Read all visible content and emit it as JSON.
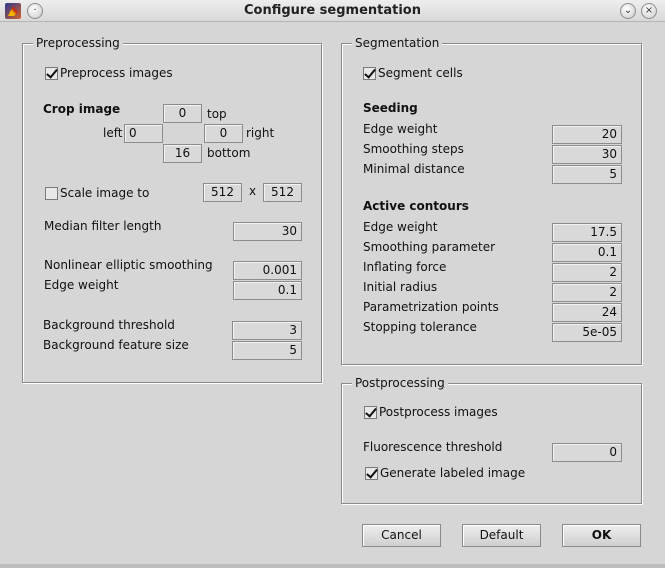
{
  "window": {
    "title": "Configure segmentation",
    "icon": "matlab-icon"
  },
  "preprocessing": {
    "title": "Preprocessing",
    "preprocess_label": "Preprocess images",
    "preprocess_checked": true,
    "crop_label": "Crop image",
    "crop_top_label": "top",
    "crop_left_label": "left",
    "crop_right_label": "right",
    "crop_bottom_label": "bottom",
    "crop_top": "0",
    "crop_left": "0",
    "crop_right": "0",
    "crop_bottom": "16",
    "scale_label": "Scale image to",
    "scale_checked": false,
    "scale_w": "512",
    "scale_x": "x",
    "scale_h": "512",
    "median_label": "Median filter length",
    "median_value": "30",
    "nonlinear_label": "Nonlinear elliptic smoothing",
    "nonlinear_value": "0.001",
    "edge_weight_label": "Edge weight",
    "edge_weight_value": "0.1",
    "bg_threshold_label": "Background threshold",
    "bg_threshold_value": "3",
    "bg_feature_label": "Background feature size",
    "bg_feature_value": "5"
  },
  "segmentation": {
    "title": "Segmentation",
    "segment_label": "Segment cells",
    "segment_checked": true,
    "seeding_title": "Seeding",
    "edge_weight_label": "Edge weight",
    "edge_weight_value": "20",
    "smoothing_steps_label": "Smoothing steps",
    "smoothing_steps_value": "30",
    "min_distance_label": "Minimal distance",
    "min_distance_value": "5",
    "active_title": "Active contours",
    "ac_edge_weight_label": "Edge weight",
    "ac_edge_weight_value": "17.5",
    "smoothing_param_label": "Smoothing parameter",
    "smoothing_param_value": "0.1",
    "inflating_label": "Inflating force",
    "inflating_value": "2",
    "initial_radius_label": "Initial radius",
    "initial_radius_value": "2",
    "param_points_label": "Parametrization points",
    "param_points_value": "24",
    "stop_tol_label": "Stopping tolerance",
    "stop_tol_value": "5e-05"
  },
  "postprocessing": {
    "title": "Postprocessing",
    "postprocess_label": "Postprocess images",
    "postprocess_checked": true,
    "fluor_label": "Fluorescence threshold",
    "fluor_value": "0",
    "labeled_label": "Generate labeled image",
    "labeled_checked": true
  },
  "buttons": {
    "cancel": "Cancel",
    "default": "Default",
    "ok": "OK"
  }
}
